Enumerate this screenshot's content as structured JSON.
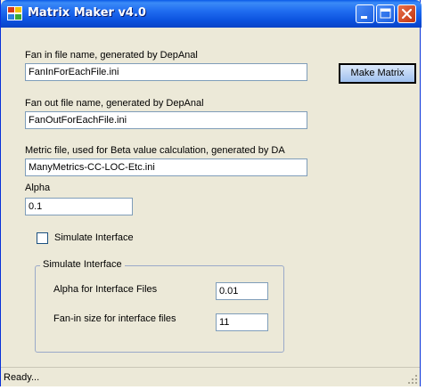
{
  "window": {
    "title": "Matrix Maker v4.0",
    "status": "Ready..."
  },
  "form": {
    "fan_in": {
      "label": "Fan in file name, generated by DepAnal",
      "value": "FanInForEachFile.ini"
    },
    "fan_out": {
      "label": "Fan out file name, generated by DepAnal",
      "value": "FanOutForEachFile.ini"
    },
    "metric": {
      "label": "Metric file, used for Beta value calculation, generated by DA",
      "value": "ManyMetrics-CC-LOC-Etc.ini"
    },
    "alpha": {
      "label": "Alpha",
      "value": "0.1"
    },
    "make_matrix_label": "Make Matrix",
    "simulate_checkbox_label": "Simulate Interface",
    "simulate_checked": false
  },
  "simulate_group": {
    "legend": "Simulate Interface",
    "alpha_interface": {
      "label": "Alpha for Interface Files",
      "value": "0.01"
    },
    "fanin_interface": {
      "label": "Fan-in size for interface files",
      "value": "11"
    }
  },
  "icons": {
    "app": "app-icon",
    "minimize": "minimize-icon",
    "maximize": "maximize-icon",
    "close": "close-icon",
    "grip": "resize-grip-icon"
  },
  "colors": {
    "titlebar": "#0b51de",
    "window_bg": "#ece9d8",
    "close_button": "#c2350f",
    "button_face": "#b7d0f4"
  }
}
